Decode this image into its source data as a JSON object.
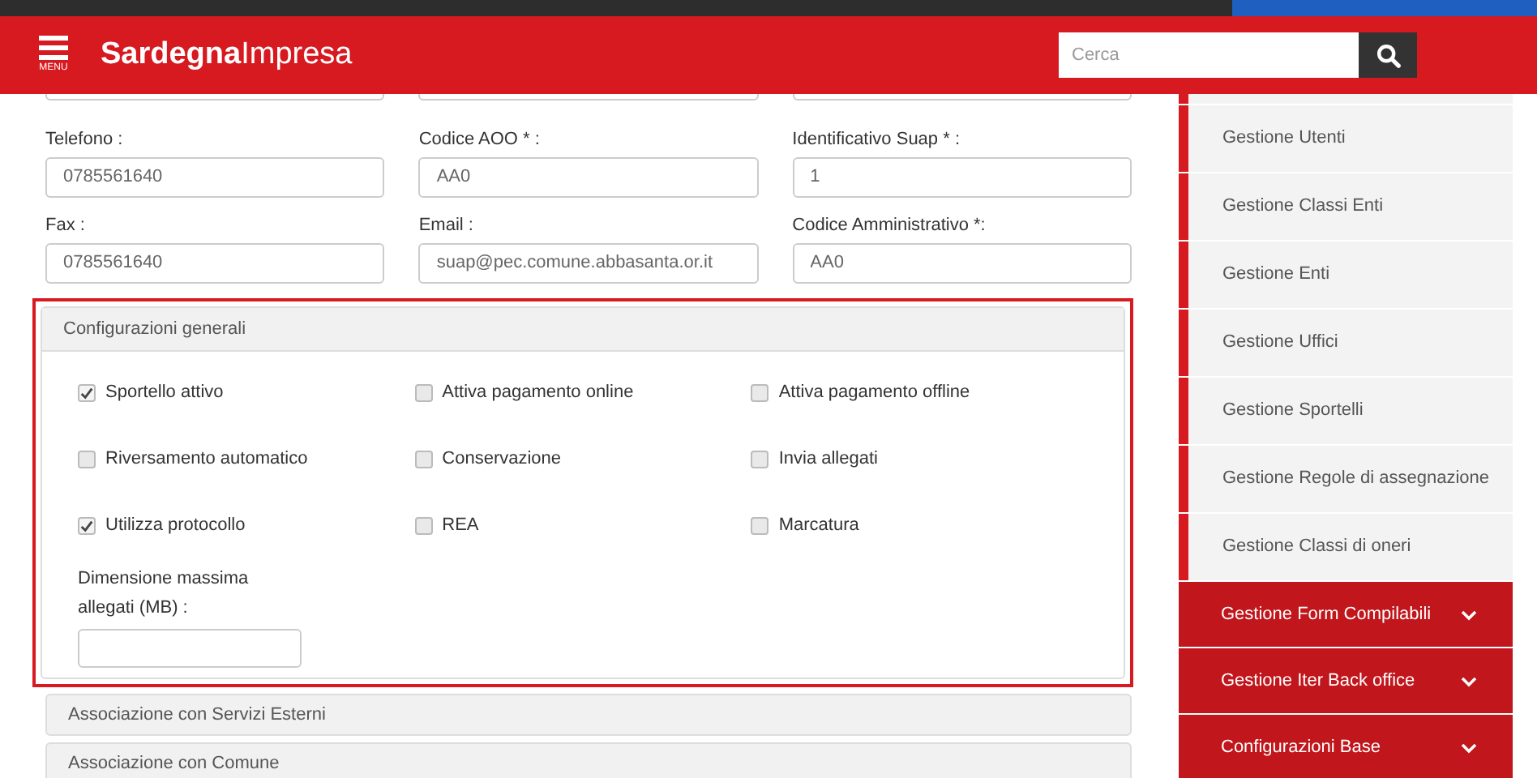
{
  "header": {
    "menu_label": "MENU",
    "logo_bold": "Sardegna",
    "logo_light": "Impresa",
    "search": {
      "placeholder": "Cerca"
    }
  },
  "fields": [
    {
      "label": "Telefono :",
      "value": "0785561640"
    },
    {
      "label": "Codice AOO * :",
      "value": "AA0"
    },
    {
      "label": "Identificativo Suap * :",
      "value": "1"
    },
    {
      "label": "Fax :",
      "value": "0785561640"
    },
    {
      "label": "Email :",
      "value": "suap@pec.comune.abbasanta.or.it"
    },
    {
      "label": "Codice Amministrativo *:",
      "value": "AA0"
    }
  ],
  "panel": {
    "title": "Configurazioni generali",
    "options": [
      {
        "label": "Sportello attivo",
        "checked": true
      },
      {
        "label": "Attiva pagamento online",
        "checked": false
      },
      {
        "label": "Attiva pagamento offline",
        "checked": false
      },
      {
        "label": "Riversamento automatico",
        "checked": false
      },
      {
        "label": "Conservazione",
        "checked": false
      },
      {
        "label": "Invia allegati",
        "checked": false
      },
      {
        "label": "Utilizza protocollo",
        "checked": true
      },
      {
        "label": "REA",
        "checked": false
      },
      {
        "label": "Marcatura",
        "checked": false
      }
    ],
    "size_label": "Dimensione massima allegati (MB) :"
  },
  "accordions": [
    "Associazione con Servizi Esterni",
    "Associazione con Comune"
  ],
  "sidebar": {
    "items": [
      {
        "label": "Gestione Utenti",
        "kind": "link"
      },
      {
        "label": "Gestione Classi Enti",
        "kind": "link"
      },
      {
        "label": "Gestione Enti",
        "kind": "link"
      },
      {
        "label": "Gestione Uffici",
        "kind": "link"
      },
      {
        "label": "Gestione Sportelli",
        "kind": "link"
      },
      {
        "label": "Gestione Regole di assegnazione",
        "kind": "link"
      },
      {
        "label": "Gestione Classi di oneri",
        "kind": "link"
      },
      {
        "label": "Gestione Form Compilabili",
        "kind": "group"
      },
      {
        "label": "Gestione Iter Back office",
        "kind": "group"
      },
      {
        "label": "Configurazioni Base",
        "kind": "group"
      }
    ]
  }
}
